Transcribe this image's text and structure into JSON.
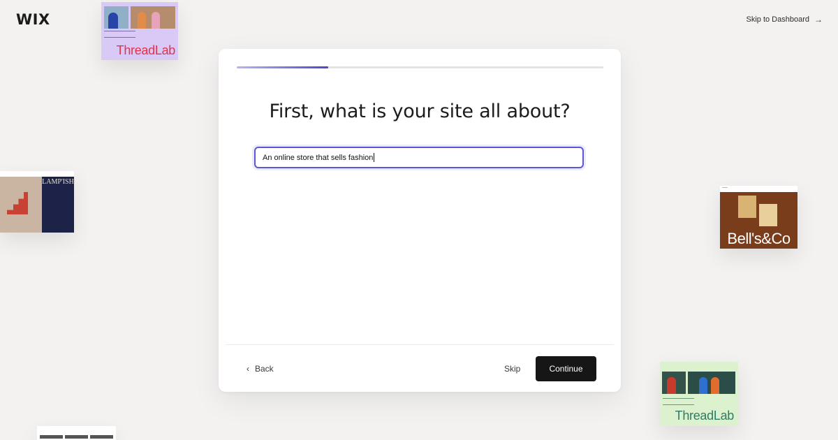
{
  "header": {
    "logo": "WIX",
    "skip_to_dashboard": "Skip to Dashboard",
    "arrow_icon": "arrow-right-icon"
  },
  "thumbnails": [
    {
      "name": "ThreadLab",
      "bg": "#d8c9f6",
      "text_color": "#e0344b"
    },
    {
      "name": "LAMP'ISH"
    },
    {
      "name": "Bell's&Co",
      "bg": "#7a3d1c"
    },
    {
      "name": "ThreadLab",
      "bg": "#dcf2cf",
      "text_color": "#2f7b67"
    }
  ],
  "wizard": {
    "progress": 0.25,
    "question": "First, what is your site all about?",
    "answer_value": "An online store that sells fashion",
    "back_label": "Back",
    "skip_label": "Skip",
    "continue_label": "Continue"
  },
  "colors": {
    "accent": "#5a57d6",
    "button": "#161616",
    "background": "#f3f2f1"
  }
}
